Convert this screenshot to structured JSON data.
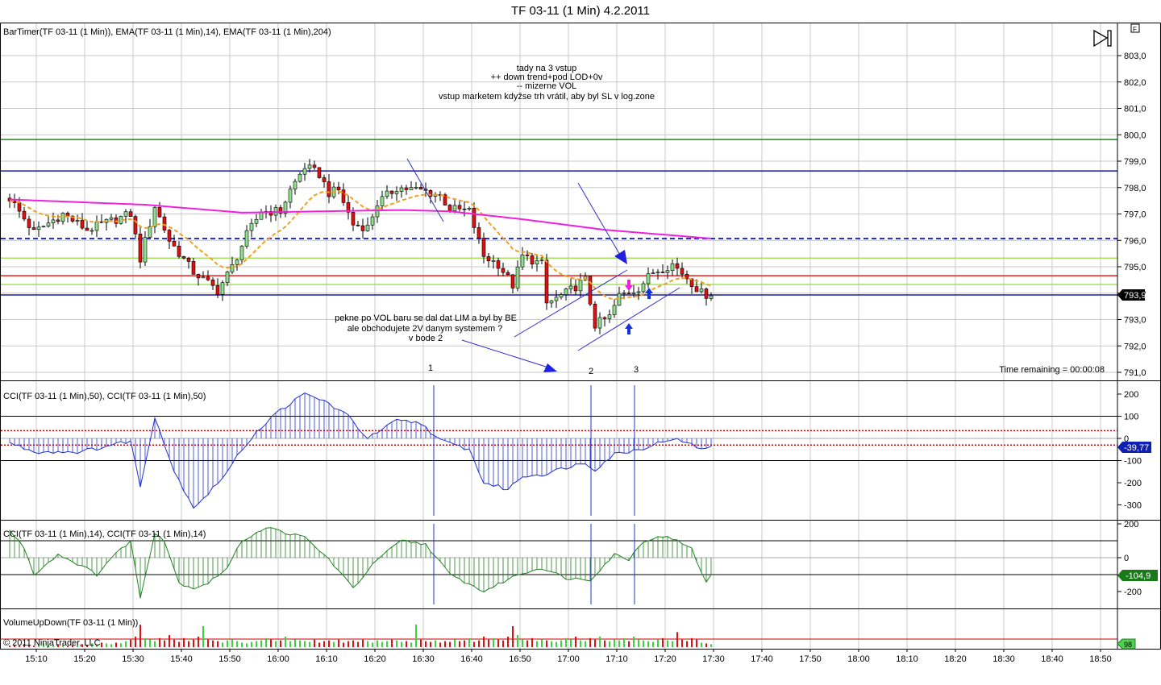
{
  "window_title": "TF 03-11 (1 Min)  4.2.2011",
  "copyright": "© 2011 NinjaTrader, LLC",
  "chart_data": [
    {
      "type": "candlestick",
      "panel_label": "BarTimer(TF 03-11 (1 Min)), EMA(TF 03-11 (1 Min),14), EMA(TF 03-11 (1 Min),204)",
      "ylim": [
        790.8,
        803.6
      ],
      "y_ticks": [
        "803,0",
        "802,0",
        "801,0",
        "800,0",
        "799,0",
        "798,0",
        "797,0",
        "796,0",
        "795,0",
        "794,0",
        "793,0",
        "792,0",
        "791,0"
      ],
      "y_tick_values": [
        803,
        802,
        801,
        800,
        799,
        798,
        797,
        796,
        795,
        794,
        793,
        792,
        791
      ],
      "last_price_label": "793,9",
      "last_price": 793.9,
      "first_bar_time": "15:04",
      "bar_minutes": 1,
      "close_keypoints": [
        [
          0,
          797.6
        ],
        [
          5,
          796.3
        ],
        [
          11,
          797.0
        ],
        [
          16,
          796.4
        ],
        [
          25,
          797.0
        ],
        [
          27,
          795.3
        ],
        [
          30,
          797.3
        ],
        [
          33,
          796.0
        ],
        [
          38,
          794.8
        ],
        [
          43,
          794.1
        ],
        [
          46,
          795.0
        ],
        [
          49,
          796.2
        ],
        [
          52,
          797.1
        ],
        [
          56,
          797.1
        ],
        [
          58,
          797.9
        ],
        [
          61,
          798.8
        ],
        [
          64,
          798.5
        ],
        [
          66,
          797.8
        ],
        [
          68,
          797.9
        ],
        [
          71,
          796.6
        ],
        [
          74,
          796.5
        ],
        [
          76,
          797.4
        ],
        [
          80,
          798.0
        ],
        [
          85,
          797.9
        ],
        [
          89,
          797.7
        ],
        [
          91,
          797.2
        ],
        [
          95,
          797.1
        ],
        [
          98,
          795.4
        ],
        [
          101,
          795.1
        ],
        [
          104,
          794.3
        ],
        [
          106,
          795.4
        ],
        [
          110,
          795.1
        ],
        [
          111,
          793.6
        ],
        [
          115,
          794.0
        ],
        [
          119,
          794.5
        ],
        [
          121,
          792.8
        ],
        [
          124,
          793.1
        ],
        [
          126,
          793.9
        ],
        [
          130,
          794.2
        ],
        [
          133,
          794.8
        ],
        [
          137,
          795.1
        ],
        [
          140,
          794.6
        ],
        [
          143,
          794.0
        ],
        [
          145,
          793.9
        ]
      ],
      "ema14_period": 14,
      "ema204_keypoints": [
        [
          0,
          797.55
        ],
        [
          28,
          797.35
        ],
        [
          48,
          797.05
        ],
        [
          65,
          797.1
        ],
        [
          81,
          797.15
        ],
        [
          91,
          797.1
        ],
        [
          106,
          796.8
        ],
        [
          123,
          796.4
        ],
        [
          145,
          796.07
        ]
      ],
      "horizontal_lines": [
        {
          "price": 799.82,
          "color": "#1a8a1a",
          "style": "solid"
        },
        {
          "price": 798.63,
          "color": "#1a1aa0",
          "style": "solid"
        },
        {
          "price": 796.07,
          "color": "#2030e0",
          "style": "dashed"
        },
        {
          "price": 795.33,
          "color": "#a6e060",
          "style": "solid"
        },
        {
          "price": 794.66,
          "color": "#e02020",
          "style": "solid"
        },
        {
          "price": 794.33,
          "color": "#a6e060",
          "style": "solid"
        },
        {
          "price": 793.93,
          "color": "#1a1aa0",
          "style": "solid"
        }
      ],
      "annotations": {
        "note_top": [
          "tady na 3 vstup",
          "++ down trend+pod LOD+0v",
          "--  mizerne VOL",
          "vstup marketem kdyžse trh vrátil, aby byl SL v log.zone"
        ],
        "note_bottom": [
          "pekne po VOL baru se dal dat LIM a byl by BE",
          "ale obchodujete 2V danym systemem ?",
          "v bode 2"
        ],
        "markers": [
          "1",
          "2",
          "3"
        ],
        "timer": "Time remaining = 00:00:08"
      },
      "colors": {
        "up": "#90e090",
        "down": "#dd1111",
        "ema14": "#f0a020",
        "ema204": "#ee22dd"
      }
    },
    {
      "type": "histogram-line",
      "panel_label": "CCI(TF 03-11 (1 Min),50), CCI(TF 03-11 (1 Min),50)",
      "y_ticks": [
        "200",
        "100",
        "0",
        "-100",
        "-200",
        "-300"
      ],
      "y_tick_values": [
        200,
        100,
        0,
        -100,
        -200,
        -300
      ],
      "current_label": "-39,77",
      "keypoints": [
        [
          0,
          -20
        ],
        [
          5,
          -60
        ],
        [
          15,
          -60
        ],
        [
          25,
          -10
        ],
        [
          27,
          -220
        ],
        [
          30,
          100
        ],
        [
          34,
          -150
        ],
        [
          38,
          -310
        ],
        [
          41,
          -250
        ],
        [
          45,
          -150
        ],
        [
          48,
          -50
        ],
        [
          51,
          30
        ],
        [
          56,
          130
        ],
        [
          61,
          200
        ],
        [
          65,
          170
        ],
        [
          70,
          100
        ],
        [
          74,
          0
        ],
        [
          80,
          80
        ],
        [
          85,
          70
        ],
        [
          89,
          -10
        ],
        [
          95,
          -50
        ],
        [
          98,
          -200
        ],
        [
          103,
          -230
        ],
        [
          106,
          -170
        ],
        [
          111,
          -160
        ],
        [
          115,
          -130
        ],
        [
          119,
          -110
        ],
        [
          121,
          -140
        ],
        [
          125,
          -70
        ],
        [
          130,
          -50
        ],
        [
          137,
          0
        ],
        [
          141,
          -30
        ],
        [
          144,
          -50
        ],
        [
          145,
          -40
        ]
      ],
      "color": "#2030d0",
      "dotted_levels": [
        35,
        -30
      ]
    },
    {
      "type": "histogram-line",
      "panel_label": "CCI(TF 03-11 (1 Min),14), CCI(TF 03-11 (1 Min),14)",
      "y_ticks": [
        "200",
        "0",
        "-200"
      ],
      "y_tick_values": [
        200,
        0,
        -200
      ],
      "current_label": "-104,9",
      "keypoints": [
        [
          0,
          160
        ],
        [
          3,
          60
        ],
        [
          5,
          -100
        ],
        [
          10,
          20
        ],
        [
          15,
          -50
        ],
        [
          18,
          -100
        ],
        [
          21,
          0
        ],
        [
          25,
          100
        ],
        [
          27,
          -240
        ],
        [
          30,
          150
        ],
        [
          32,
          100
        ],
        [
          35,
          -150
        ],
        [
          38,
          -180
        ],
        [
          41,
          -150
        ],
        [
          45,
          -60
        ],
        [
          48,
          100
        ],
        [
          53,
          180
        ],
        [
          58,
          140
        ],
        [
          61,
          120
        ],
        [
          66,
          -10
        ],
        [
          71,
          -180
        ],
        [
          76,
          -10
        ],
        [
          81,
          100
        ],
        [
          86,
          80
        ],
        [
          91,
          -100
        ],
        [
          98,
          -200
        ],
        [
          105,
          -100
        ],
        [
          110,
          -60
        ],
        [
          115,
          -120
        ],
        [
          120,
          -130
        ],
        [
          125,
          20
        ],
        [
          128,
          -10
        ],
        [
          131,
          100
        ],
        [
          136,
          130
        ],
        [
          141,
          50
        ],
        [
          144,
          -150
        ],
        [
          145,
          -105
        ]
      ],
      "color": "#208020"
    },
    {
      "type": "bar",
      "panel_label": "VolumeUpDown(TF 03-11 (1 Min))",
      "current_label": "98",
      "values": [
        2,
        3,
        2,
        4,
        3,
        2,
        3,
        5,
        3,
        2,
        4,
        3,
        2,
        3,
        2,
        4,
        3,
        5,
        4,
        6,
        5,
        4,
        6,
        5,
        8,
        10,
        14,
        30,
        12,
        10,
        8,
        12,
        9,
        16,
        10,
        7,
        12,
        8,
        10,
        14,
        28,
        10,
        9,
        8,
        6,
        9,
        10,
        8,
        6,
        5,
        7,
        8,
        9,
        12,
        10,
        8,
        9,
        14,
        8,
        10,
        9,
        8,
        7,
        10,
        6,
        8,
        9,
        7,
        10,
        6,
        8,
        9,
        7,
        10,
        8,
        6,
        9,
        7,
        8,
        10,
        9,
        7,
        8,
        6,
        30,
        10,
        8,
        7,
        9,
        6,
        8,
        7,
        10,
        8,
        9,
        12,
        7,
        9,
        14,
        10,
        12,
        10,
        9,
        14,
        28,
        16,
        10,
        9,
        12,
        8,
        10,
        9,
        8,
        7,
        9,
        12,
        10,
        14,
        9,
        8,
        12,
        10,
        14,
        9,
        8,
        10,
        9,
        12,
        8,
        14,
        10,
        9,
        8,
        7,
        10,
        12,
        9,
        8,
        20,
        10,
        8,
        12,
        10,
        6,
        5,
        4
      ]
    }
  ],
  "x_ticks": [
    "15:10",
    "15:20",
    "15:30",
    "15:40",
    "15:50",
    "16:00",
    "16:10",
    "16:20",
    "16:30",
    "16:40",
    "16:50",
    "17:00",
    "17:10",
    "17:20",
    "17:30",
    "17:40",
    "17:50",
    "18:00",
    "18:10",
    "18:20",
    "18:30",
    "18:40",
    "18:50"
  ]
}
